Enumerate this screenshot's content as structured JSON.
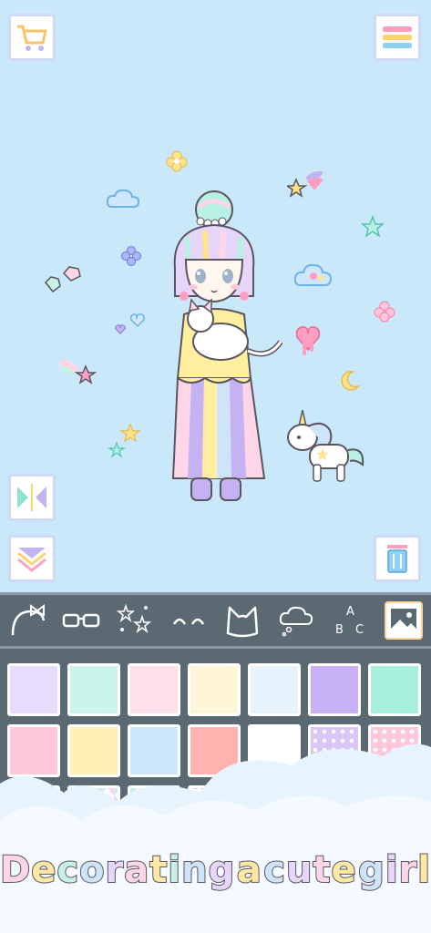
{
  "top_bar": {
    "shop_icon": "shopping-cart-icon",
    "menu_icon": "hamburger-menu-icon"
  },
  "side_buttons": {
    "flip_icon": "flip-horizontal-icon",
    "layer_icon": "layer-down-icon",
    "delete_icon": "trash-icon"
  },
  "categories": [
    {
      "name": "headband",
      "icon": "headband-icon"
    },
    {
      "name": "glasses",
      "icon": "glasses-icon"
    },
    {
      "name": "sparkles",
      "icon": "sparkles-icon"
    },
    {
      "name": "eyes",
      "icon": "eyes-icon"
    },
    {
      "name": "cat-ears",
      "icon": "cat-ears-icon"
    },
    {
      "name": "speech",
      "icon": "thought-bubble-icon"
    },
    {
      "name": "letters",
      "icon": "abc-letters-icon"
    },
    {
      "name": "background",
      "icon": "background-picture-icon",
      "selected": true
    }
  ],
  "swatches": [
    {
      "color": "#e6dcfb"
    },
    {
      "color": "#c9f5eb"
    },
    {
      "color": "#ffe0ea"
    },
    {
      "color": "#fff6d8"
    },
    {
      "color": "#e6f3fd"
    },
    {
      "color": "#c8b2f5"
    },
    {
      "color": "#a8f0dd"
    },
    {
      "color": "#ffc7dc"
    },
    {
      "color": "#fff0b5"
    },
    {
      "color": "#cfe7fb"
    },
    {
      "color": "#ffb3b0"
    },
    {
      "color": "#ffffff"
    },
    {
      "color": "#d9c6f7",
      "pattern": "dots"
    },
    {
      "color": "#ffc7dc",
      "pattern": "dots"
    },
    {
      "color": "#ffffff",
      "pattern": "triangles"
    },
    {
      "color": "#ffffff",
      "pattern": "triangles"
    },
    {
      "color": "#ffffff",
      "pattern": "triangles"
    },
    {
      "color": "#d9c6f7",
      "pattern": "checks"
    }
  ],
  "caption": {
    "letters": [
      "D",
      "e",
      "c",
      "o",
      "r",
      "a",
      "t",
      "i",
      "n",
      "g",
      " ",
      "a",
      " ",
      "c",
      "u",
      "t",
      "e",
      " ",
      "g",
      "i",
      "r",
      "l"
    ],
    "colors": [
      "#ffd6e8",
      "#ffe8a3",
      "#c7f0e6",
      "#cfe4fb",
      "#e6d6fb",
      "#ffd6e8",
      "#ffe8a3",
      "#c7f0e6",
      "#cfe4fb",
      "#e6d6fb"
    ]
  },
  "colors": {
    "background": "#c9e8fa",
    "toolbar": "#5b6972",
    "accent_pink": "#ffb8cf",
    "accent_yellow": "#ffe48a",
    "accent_mint": "#9fe9d8",
    "accent_lavender": "#c5b2f3"
  }
}
